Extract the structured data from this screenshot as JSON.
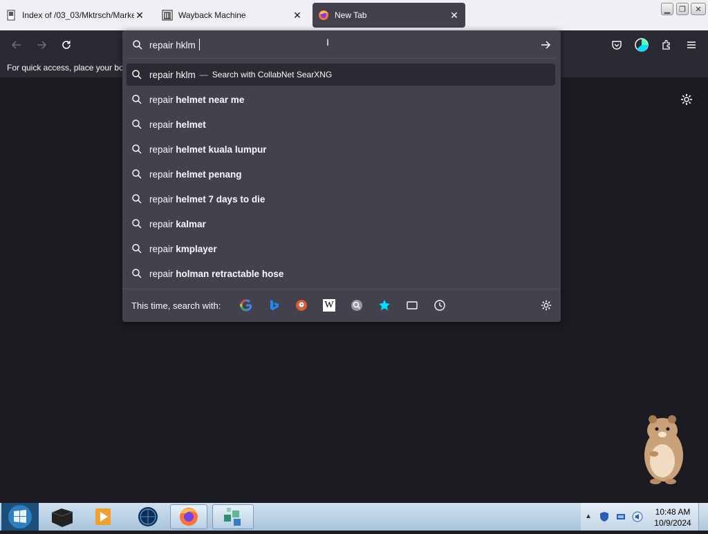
{
  "tabs": [
    {
      "title": "Index of /03_03/Mktrsch/Marke",
      "close": "✕"
    },
    {
      "title": "Wayback Machine",
      "close": "✕"
    },
    {
      "title": "New Tab",
      "close": "✕"
    }
  ],
  "bookmarks_bar": {
    "text": "For quick access, place your boo"
  },
  "urlbar": {
    "value": "repair hklm "
  },
  "suggestions": [
    {
      "prefix": "repair hklm",
      "bold": "",
      "separator": "—",
      "action": "Search with CollabNet SearXNG"
    },
    {
      "prefix": "repair",
      "bold": "helmet near me"
    },
    {
      "prefix": "repair",
      "bold": "helmet"
    },
    {
      "prefix": "repair",
      "bold": "helmet kuala lumpur"
    },
    {
      "prefix": "repair",
      "bold": "helmet penang"
    },
    {
      "prefix": "repair",
      "bold": "helmet 7 days to die"
    },
    {
      "prefix": "repair",
      "bold": "kalmar"
    },
    {
      "prefix": "repair",
      "bold": "kmplayer"
    },
    {
      "prefix": "repair",
      "bold": "holman retractable hose"
    }
  ],
  "one_off": {
    "label": "This time, search with:",
    "engines": [
      "google-icon",
      "bing-icon",
      "duckduckgo-icon",
      "wikipedia-icon",
      "searxng-icon",
      "bookmarks-icon",
      "tabs-icon",
      "history-icon"
    ],
    "wiki_letter": "W"
  },
  "taskbar": {
    "time": "10:48 AM",
    "date": "10/9/2024"
  },
  "colors": {
    "toolbar": "#2b2a33",
    "panel": "#42414d",
    "content": "#1c1b22",
    "accent": "#0060df"
  }
}
